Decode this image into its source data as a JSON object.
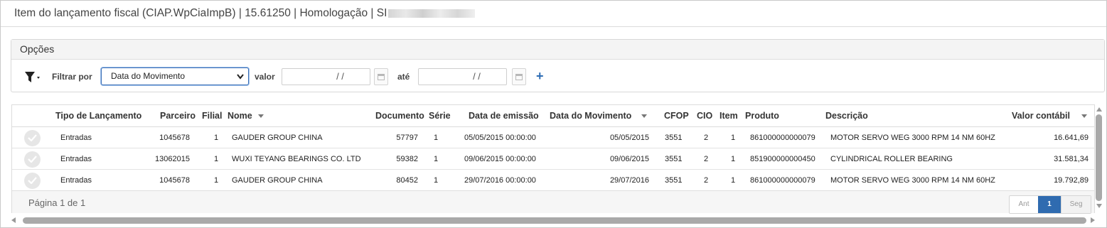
{
  "window": {
    "title": "Item do lançamento fiscal (CIAP.WpCiaImpB) | 15.61250 | Homologação | SI"
  },
  "options": {
    "header": "Opções",
    "filter_label": "Filtrar por",
    "filter_selected": "Data do Movimento",
    "valor_label": "valor",
    "ate_label": "até",
    "date_from": "/ /",
    "date_to": "/ /",
    "add_label": "+"
  },
  "grid": {
    "columns": [
      "Tipo de Lançamento",
      "Parceiro",
      "Filial",
      "Nome",
      "Documento",
      "Série",
      "Data de emissão",
      "Data do Movimento",
      "CFOP",
      "CIO",
      "Item",
      "Produto",
      "Descrição",
      "Valor contábil"
    ],
    "rows": [
      {
        "tipo": "Entradas",
        "parceiro": "1045678",
        "filial": "1",
        "nome": "GAUDER GROUP CHINA",
        "documento": "57797",
        "serie": "1",
        "emissao": "05/05/2015 00:00:00",
        "movimento": "05/05/2015",
        "cfop": "3551",
        "cio": "2",
        "item": "1",
        "produto": "861000000000079",
        "descricao": "MOTOR SERVO WEG 3000 RPM 14 NM 60HZ",
        "valor": "16.641,69"
      },
      {
        "tipo": "Entradas",
        "parceiro": "13062015",
        "filial": "1",
        "nome": "WUXI TEYANG BEARINGS CO. LTD",
        "documento": "59382",
        "serie": "1",
        "emissao": "09/06/2015 00:00:00",
        "movimento": "09/06/2015",
        "cfop": "3551",
        "cio": "2",
        "item": "1",
        "produto": "851900000000450",
        "descricao": "CYLINDRICAL ROLLER BEARING",
        "valor": "31.581,34"
      },
      {
        "tipo": "Entradas",
        "parceiro": "1045678",
        "filial": "1",
        "nome": "GAUDER GROUP CHINA",
        "documento": "80452",
        "serie": "1",
        "emissao": "29/07/2016 00:00:00",
        "movimento": "29/07/2016",
        "cfop": "3551",
        "cio": "2",
        "item": "1",
        "produto": "861000000000079",
        "descricao": "MOTOR SERVO WEG 3000 RPM 14 NM 60HZ",
        "valor": "19.792,89"
      }
    ],
    "page_info": "Página 1 de 1",
    "pager": {
      "prev": "Ant",
      "current": "1",
      "next": "Seg"
    }
  },
  "icons": {
    "filter": "funnel-icon",
    "calendar": "calendar-icon",
    "row_status": "check-circle-icon",
    "sort": "sort-down-icon"
  },
  "colors": {
    "accent": "#2f6bb0",
    "select_border": "#3b6fb6"
  }
}
